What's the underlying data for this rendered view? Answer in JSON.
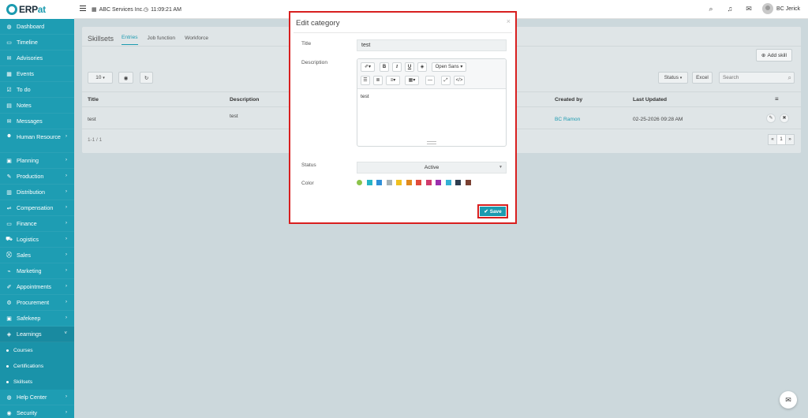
{
  "brand": {
    "name_a": "ERP",
    "name_b": "at"
  },
  "topbar": {
    "company": "ABC Services Inc.",
    "time": "11:09:21 AM",
    "user": "BC Jerick"
  },
  "sidebar": {
    "items": [
      {
        "label": "Dashboard",
        "icon": "◍",
        "chevron": ""
      },
      {
        "label": "Timeline",
        "icon": "▭",
        "chevron": ""
      },
      {
        "label": "Advisories",
        "icon": "✉",
        "chevron": ""
      },
      {
        "label": "Events",
        "icon": "▦",
        "chevron": ""
      },
      {
        "label": "To do",
        "icon": "☑",
        "chevron": ""
      },
      {
        "label": "Notes",
        "icon": "▤",
        "chevron": ""
      },
      {
        "label": "Messages",
        "icon": "✉",
        "chevron": ""
      },
      {
        "label": "Human Resource",
        "icon": "☻",
        "chevron": "›"
      },
      {
        "label": "Planning",
        "icon": "▣",
        "chevron": "›"
      },
      {
        "label": "Production",
        "icon": "✎",
        "chevron": "›"
      },
      {
        "label": "Distribution",
        "icon": "▥",
        "chevron": "›"
      },
      {
        "label": "Compensation",
        "icon": "⇌",
        "chevron": "›"
      },
      {
        "label": "Finance",
        "icon": "▭",
        "chevron": "›"
      },
      {
        "label": "Logistics",
        "icon": "⛟",
        "chevron": "›"
      },
      {
        "label": "Sales",
        "icon": "⛒",
        "chevron": "›"
      },
      {
        "label": "Marketing",
        "icon": "⌁",
        "chevron": "›"
      },
      {
        "label": "Appointments",
        "icon": "✐",
        "chevron": "›"
      },
      {
        "label": "Procurement",
        "icon": "⚙",
        "chevron": "›"
      },
      {
        "label": "Safekeep",
        "icon": "▣",
        "chevron": "›"
      },
      {
        "label": "Learnings",
        "icon": "◈",
        "chevron": "˅"
      }
    ],
    "sub_items": [
      "Courses",
      "Certifications",
      "Skillsets"
    ],
    "bottom_items": [
      {
        "label": "Help Center",
        "icon": "◍",
        "chevron": "›"
      },
      {
        "label": "Security",
        "icon": "◉",
        "chevron": "›"
      }
    ]
  },
  "page": {
    "title": "Skillsets",
    "tabs": [
      "Entries",
      "Job function",
      "Workforce"
    ],
    "add_label": "Add skill",
    "page_size": "10",
    "status_filter": "Status",
    "excel": "Excel",
    "search_placeholder": "Search",
    "columns": [
      "Title",
      "Description",
      "Created by",
      "Last Updated"
    ],
    "rows": [
      {
        "title": "test",
        "description": "test",
        "created_by": "BC Ramon",
        "last_updated": "02-25-2026 09:28 AM"
      }
    ],
    "pager_info": "1-1 / 1",
    "pager": {
      "prev": "«",
      "current": "1",
      "next": "»"
    }
  },
  "modal": {
    "title": "Edit category",
    "close": "×",
    "title_label": "Title",
    "title_value": "test",
    "description_label": "Description",
    "font_name": "Open Sans",
    "description_value": "test",
    "status_label": "Status",
    "status_value": "Active",
    "color_label": "Color",
    "colors": [
      "#8bc34a",
      "#26b5c6",
      "#2f8fd8",
      "#a8b2b5",
      "#f0c020",
      "#e08a1e",
      "#e24b3c",
      "#d13b6c",
      "#9b2fae",
      "#33b0d4",
      "#2f3d4f",
      "#7a4032"
    ],
    "save_label": "Save"
  }
}
